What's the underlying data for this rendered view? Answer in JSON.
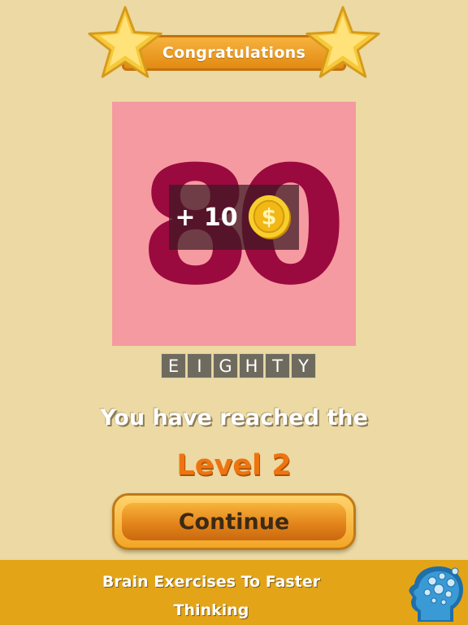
{
  "banner": {
    "title": "Congratulations",
    "icon": "star-icon"
  },
  "puzzle": {
    "image_text": "80",
    "reward": {
      "text": "+ 10",
      "icon": "coin-icon"
    }
  },
  "answer": {
    "letters": [
      "E",
      "I",
      "G",
      "H",
      "T",
      "Y"
    ]
  },
  "message": {
    "line1": "You have reached the",
    "level": "Level 2"
  },
  "continue_button": {
    "label": "Continue"
  },
  "footer": {
    "line1": "Brain Exercises To Faster",
    "line2": "Thinking",
    "logo": "brain-head-icon"
  },
  "colors": {
    "background": "#ecd9a3",
    "accent": "#ef7410",
    "footer": "#e3a418",
    "puzzle_bg": "#f59aa0",
    "number": "#9a0a3f"
  }
}
